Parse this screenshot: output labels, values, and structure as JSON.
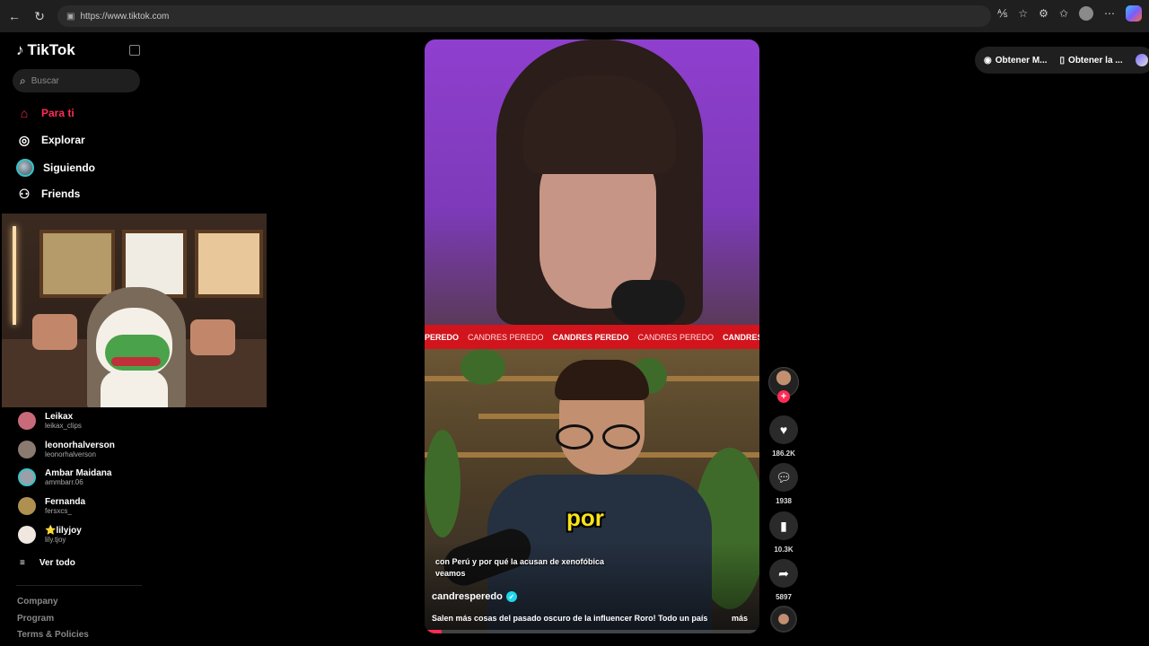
{
  "browser": {
    "url": "https://www.tiktok.com"
  },
  "app": {
    "name": "TikTok"
  },
  "search": {
    "placeholder": "Buscar"
  },
  "nav": [
    {
      "label": "Para ti",
      "icon": "home-icon",
      "active": true
    },
    {
      "label": "Explorar",
      "icon": "compass-icon"
    },
    {
      "label": "Siguiendo",
      "icon": "following-avatar-icon"
    },
    {
      "label": "Friends",
      "icon": "friends-icon"
    }
  ],
  "following": [
    {
      "name": "Leikax",
      "handle": "leikax_clips"
    },
    {
      "name": "leonorhalverson",
      "handle": "leonorhalverson"
    },
    {
      "name": "Ambar Maidana",
      "handle": "ammbarr.06"
    },
    {
      "name": "Fernanda",
      "handle": "fersxcs_"
    },
    {
      "name": "⭐lilyjoy",
      "handle": "lily.tjoy"
    }
  ],
  "see_all": "Ver todo",
  "footer_links": [
    "Company",
    "Program",
    "Terms & Policies"
  ],
  "top_pills": [
    "Obtener M...",
    "Obtener la ..."
  ],
  "video": {
    "ticker": [
      "PEREDO",
      "CANDRES PEREDO",
      "CANDRES PEREDO",
      "CANDRES PEREDO",
      "CANDRES PERED"
    ],
    "caption_word": "por",
    "subtitle": "con Perú y por qué la acusan de xenofóbica veamos",
    "author": "candresperedo",
    "description": "Salen más cosas del pasado oscuro de la influencer Roro! Todo un país",
    "more": "más",
    "progress": 0.05
  },
  "actions": {
    "likes": "186.2K",
    "comments": "1938",
    "saves": "10.3K",
    "shares": "5897"
  },
  "colors": {
    "accent": "#fe2c55",
    "ticker": "#d2141c",
    "caption": "#f7e31a"
  }
}
